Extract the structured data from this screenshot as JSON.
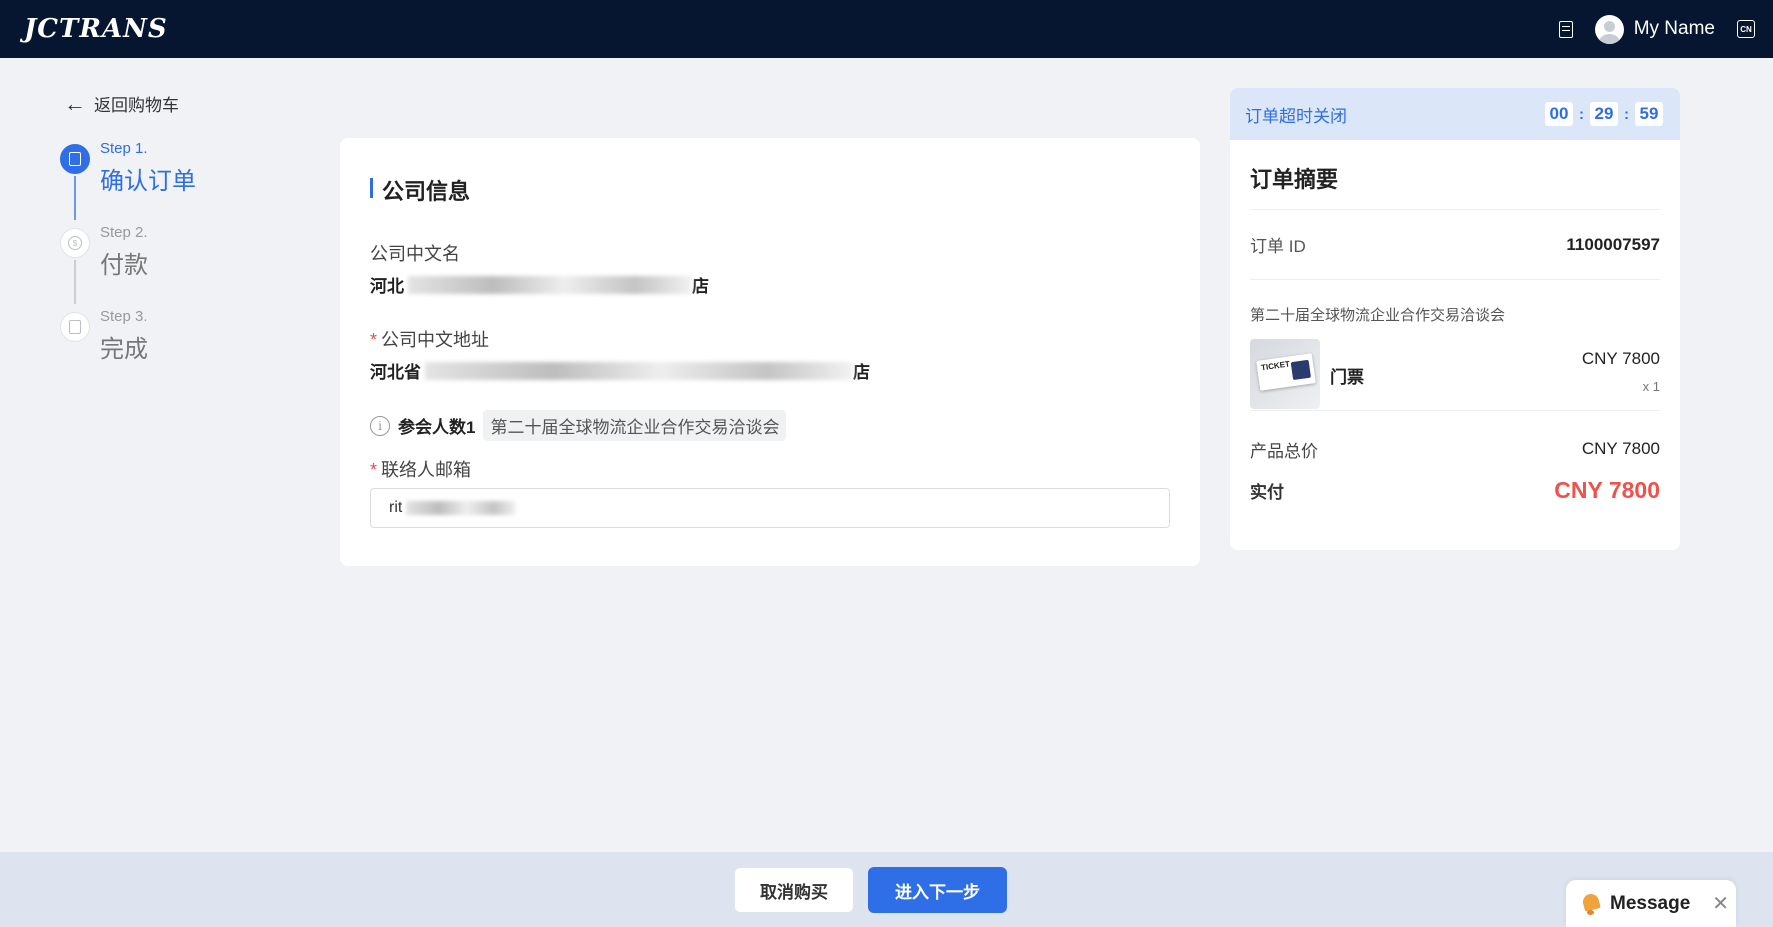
{
  "header": {
    "logo": "JCTRANS",
    "user_name": "My Name",
    "lang": "CN"
  },
  "nav": {
    "back_label": "返回购物车"
  },
  "steps": [
    {
      "label": "Step 1.",
      "title": "确认订单",
      "active": true
    },
    {
      "label": "Step 2.",
      "title": "付款",
      "active": false
    },
    {
      "label": "Step 3.",
      "title": "完成",
      "active": false
    }
  ],
  "company": {
    "section_title": "公司信息",
    "name_label": "公司中文名",
    "name_value": "河北",
    "name_value_tail": "店",
    "address_label": "公司中文地址",
    "address_value": "河北省",
    "address_value_tail": "店",
    "attendee_label": "参会人数1",
    "attendee_event": "第二十届全球物流企业合作交易洽谈会",
    "email_label": "联络人邮箱",
    "email_value": "rit"
  },
  "summary": {
    "timer_label": "订单超时关闭",
    "timer": {
      "hh": "00",
      "mm": "29",
      "ss": "59"
    },
    "title": "订单摘要",
    "order_id_label": "订单 ID",
    "order_id": "1100007597",
    "event_name": "第二十届全球物流企业合作交易洽谈会",
    "product_name": "门票",
    "product_image_text": "TICKET",
    "product_price": "CNY 7800",
    "product_qty": "x 1",
    "total_label": "产品总价",
    "total_value": "CNY 7800",
    "paid_label": "实付",
    "paid_value": "CNY 7800"
  },
  "footer": {
    "cancel_label": "取消购买",
    "next_label": "进入下一步"
  },
  "message": {
    "label": "Message"
  }
}
